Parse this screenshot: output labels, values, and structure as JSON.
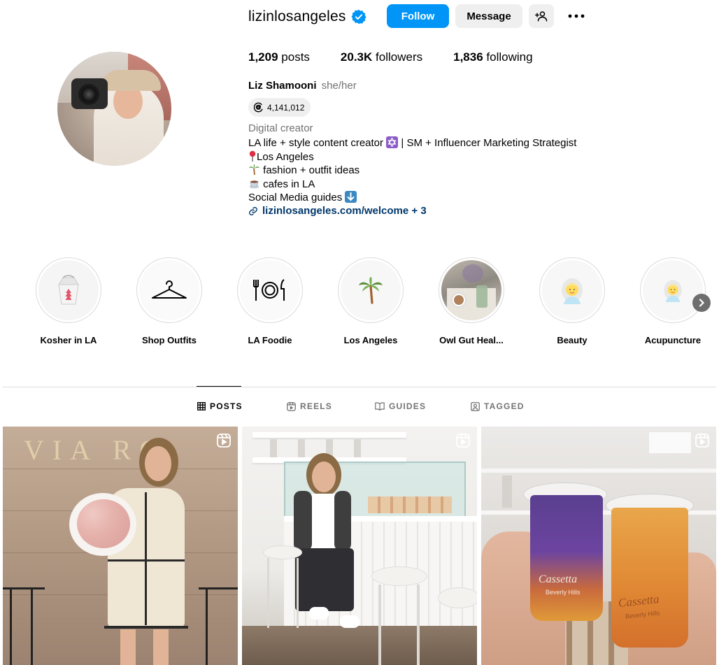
{
  "profile": {
    "username": "lizinlosangeles",
    "follow_label": "Follow",
    "message_label": "Message",
    "posts": "1,209",
    "posts_label": "posts",
    "followers": "20.3K",
    "followers_label": "followers",
    "following": "1,836",
    "following_label": "following",
    "full_name": "Liz Shamooni",
    "pronouns": "she/her",
    "threads_count": "4,141,012",
    "category": "Digital creator",
    "bio": {
      "line1": "LA life + style content creator",
      "line1_suffix": "| SM + Influencer Marketing Strategist",
      "line2": "Los Angeles",
      "line3": "fashion + outfit ideas",
      "line4": "cafes in LA",
      "line5": "Social Media guides"
    },
    "link": "lizinlosangeles.com/welcome + 3"
  },
  "highlights": [
    {
      "label": "Kosher in LA",
      "icon": "takeout-box-icon"
    },
    {
      "label": "Shop Outfits",
      "icon": "hanger-icon"
    },
    {
      "label": "LA Foodie",
      "icon": "plate-utensils-icon"
    },
    {
      "label": "Los Angeles",
      "icon": "palm-tree-icon"
    },
    {
      "label": "Owl Gut Heal...",
      "icon": "cafe-photo"
    },
    {
      "label": "Beauty",
      "icon": "woman-icon"
    },
    {
      "label": "Acupuncture",
      "icon": "woman-icon"
    }
  ],
  "tabs": {
    "posts": "POSTS",
    "reels": "REELS",
    "guides": "GUIDES",
    "tagged": "TAGGED"
  },
  "post_texts": {
    "wall_sign": "VIA RO",
    "cup_brand": "Cassetta",
    "cup_sub": "Beverly Hills"
  },
  "colors": {
    "accent": "#0095f6",
    "link": "#00376b",
    "secondary_text": "#737373"
  }
}
